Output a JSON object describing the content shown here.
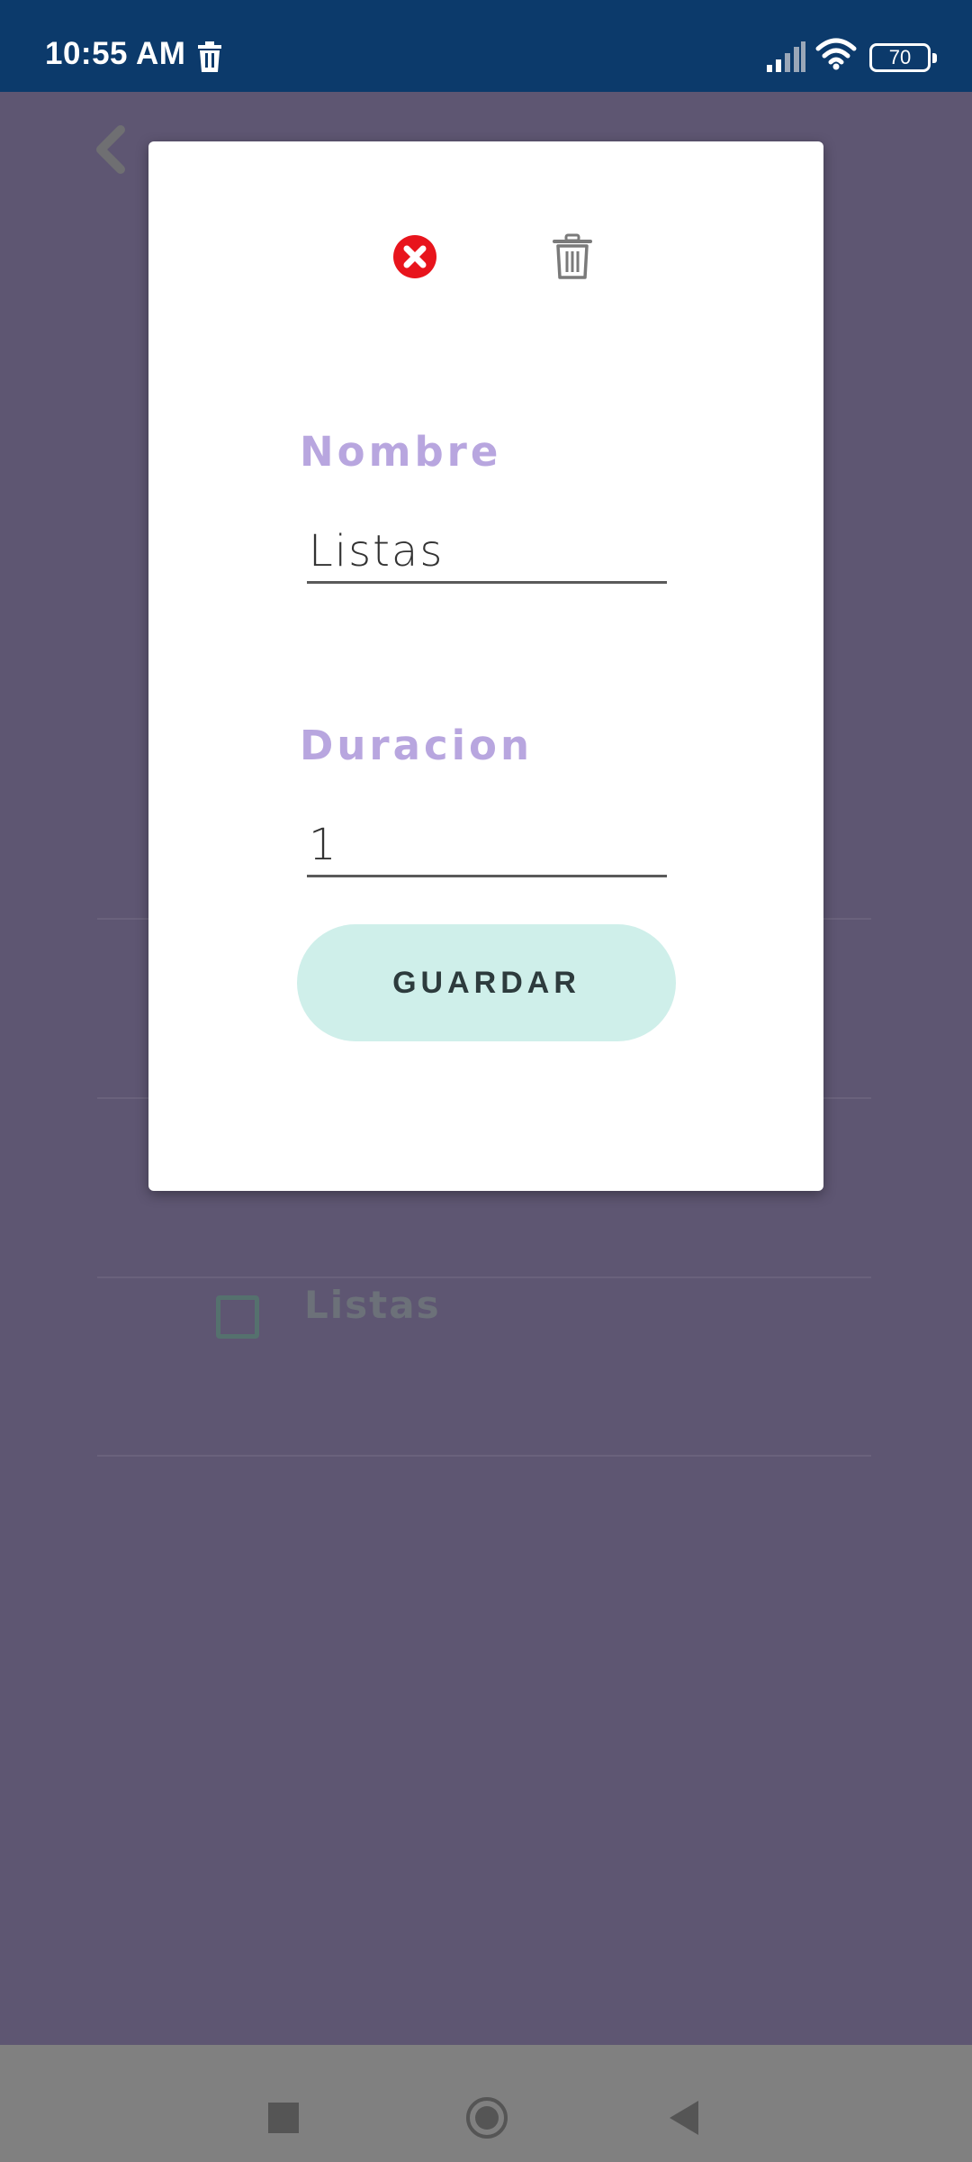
{
  "status_bar": {
    "time": "10:55 AM",
    "battery": "70",
    "icons": [
      "trash-icon",
      "signal-icon",
      "wifi-icon",
      "battery-icon"
    ]
  },
  "background": {
    "item_label": "Listas"
  },
  "dialog": {
    "close_icon_color": "#e8141c",
    "nombre_label": "Nombre",
    "nombre_value": "Listas",
    "duracion_label": "Duracion",
    "duracion_value": "1",
    "save_label": "GUARDAR",
    "label_color": "#b8a6df",
    "button_color": "#cfefea"
  },
  "nav_bar": {
    "items": [
      "recents-button",
      "home-button",
      "back-button"
    ]
  }
}
